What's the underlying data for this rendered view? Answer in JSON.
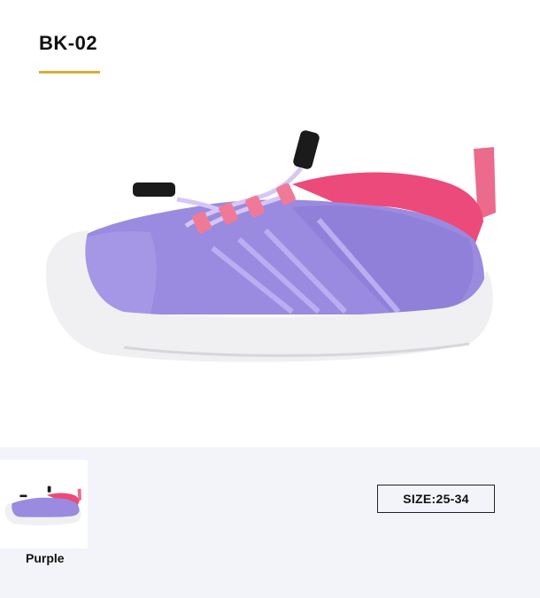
{
  "product": {
    "model_code": "BK-02",
    "accent_color": "#d9ad3b"
  },
  "hero_image": {
    "icon": "shoe-image",
    "colors": {
      "upper": "#9a8ae0",
      "sole": "#f0f0f2",
      "collar": "#ec4a7a",
      "laces": "#d7c6f5",
      "toggle": "#1b1b1b"
    }
  },
  "variants": {
    "items": [
      {
        "label": "Purple",
        "icon": "shoe-thumbnail"
      }
    ]
  },
  "size": {
    "label": "SIZE:25-34"
  }
}
